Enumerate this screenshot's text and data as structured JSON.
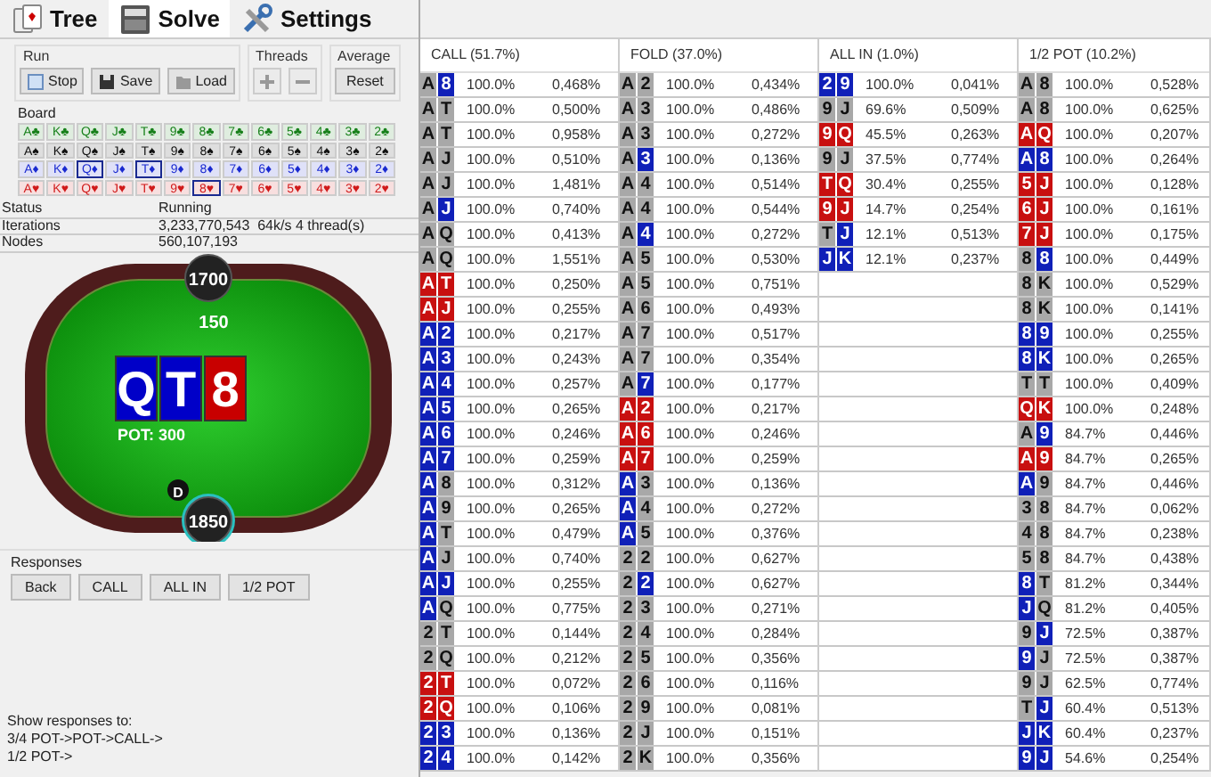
{
  "tabs": [
    {
      "label": "Tree",
      "kind": "tree",
      "selected": false
    },
    {
      "label": "Solve",
      "kind": "solve",
      "selected": true
    },
    {
      "label": "Settings",
      "kind": "settings",
      "selected": false
    }
  ],
  "run": {
    "title": "Run",
    "buttons": [
      {
        "label": "Stop",
        "kind": "stop"
      },
      {
        "label": "Save",
        "kind": "save"
      },
      {
        "label": "Load",
        "kind": "load"
      }
    ]
  },
  "threads": {
    "title": "Threads",
    "buttons": [
      {
        "kind": "plus",
        "disabled": true
      },
      {
        "kind": "minus",
        "disabled": true
      }
    ]
  },
  "average": {
    "title": "Average",
    "button": "Reset"
  },
  "board": {
    "title": "Board",
    "rows": [
      {
        "color": "#17801a",
        "cards": [
          {
            "label": "A♣",
            "selected": false
          },
          {
            "label": "K♣",
            "selected": false
          },
          {
            "label": "Q♣",
            "selected": false
          },
          {
            "label": "J♣",
            "selected": false
          },
          {
            "label": "T♣",
            "selected": false
          },
          {
            "label": "9♣",
            "selected": false
          },
          {
            "label": "8♣",
            "selected": false
          },
          {
            "label": "7♣",
            "selected": false
          },
          {
            "label": "6♣",
            "selected": false
          },
          {
            "label": "5♣",
            "selected": false
          },
          {
            "label": "4♣",
            "selected": false
          },
          {
            "label": "3♣",
            "selected": false
          },
          {
            "label": "2♣",
            "selected": false
          }
        ]
      },
      {
        "color": "#111111",
        "cards": [
          {
            "label": "A♠",
            "selected": false
          },
          {
            "label": "K♠",
            "selected": false
          },
          {
            "label": "Q♠",
            "selected": false
          },
          {
            "label": "J♠",
            "selected": false
          },
          {
            "label": "T♠",
            "selected": false
          },
          {
            "label": "9♠",
            "selected": false
          },
          {
            "label": "8♠",
            "selected": false
          },
          {
            "label": "7♠",
            "selected": false
          },
          {
            "label": "6♠",
            "selected": false
          },
          {
            "label": "5♠",
            "selected": false
          },
          {
            "label": "4♠",
            "selected": false
          },
          {
            "label": "3♠",
            "selected": false
          },
          {
            "label": "2♠",
            "selected": false
          }
        ]
      },
      {
        "color": "#1a2ad0",
        "cards": [
          {
            "label": "A♦",
            "selected": false
          },
          {
            "label": "K♦",
            "selected": false
          },
          {
            "label": "Q♦",
            "selected": true
          },
          {
            "label": "J♦",
            "selected": false
          },
          {
            "label": "T♦",
            "selected": true
          },
          {
            "label": "9♦",
            "selected": false
          },
          {
            "label": "8♦",
            "selected": false
          },
          {
            "label": "7♦",
            "selected": false
          },
          {
            "label": "6♦",
            "selected": false
          },
          {
            "label": "5♦",
            "selected": false
          },
          {
            "label": "4♦",
            "selected": false
          },
          {
            "label": "3♦",
            "selected": false
          },
          {
            "label": "2♦",
            "selected": false
          }
        ]
      },
      {
        "color": "#d01a1a",
        "cards": [
          {
            "label": "A♥",
            "selected": false
          },
          {
            "label": "K♥",
            "selected": false
          },
          {
            "label": "Q♥",
            "selected": false
          },
          {
            "label": "J♥",
            "selected": false
          },
          {
            "label": "T♥",
            "selected": false
          },
          {
            "label": "9♥",
            "selected": false
          },
          {
            "label": "8♥",
            "selected": true
          },
          {
            "label": "7♥",
            "selected": false
          },
          {
            "label": "6♥",
            "selected": false
          },
          {
            "label": "5♥",
            "selected": false
          },
          {
            "label": "4♥",
            "selected": false
          },
          {
            "label": "3♥",
            "selected": false
          },
          {
            "label": "2♥",
            "selected": false
          }
        ]
      }
    ]
  },
  "status": [
    {
      "label": "Status",
      "value": "Running"
    },
    {
      "label": "Iterations",
      "value": "3,233,770,543  64k/s 4 thread(s)"
    },
    {
      "label": "Nodes",
      "value": "560,107,193"
    }
  ],
  "table": {
    "top_stack": "1700",
    "bet": "150",
    "board": [
      {
        "rank": "Q",
        "color": "#0000c8"
      },
      {
        "rank": "T",
        "color": "#0000c8"
      },
      {
        "rank": "8",
        "color": "#c80000"
      }
    ],
    "pot": "POT: 300",
    "dealer": "D",
    "bottom_stack": "1850"
  },
  "responses": {
    "title": "Responses",
    "buttons": [
      "Back",
      "CALL",
      "ALL IN",
      "1/2 POT"
    ]
  },
  "show_responses": [
    "Show responses to:",
    "3/4 POT->POT->CALL->",
    "1/2 POT->"
  ],
  "strategy": [
    {
      "header": "CALL (51.7%)",
      "rows": [
        {
          "hand": [
            {
              "rank": "A",
              "color": "#a8a8a8"
            },
            {
              "rank": "8",
              "color": "#1020b8"
            }
          ],
          "frequency": "100.0%",
          "weight": "0,468%"
        },
        {
          "hand": [
            {
              "rank": "A",
              "color": "#a8a8a8"
            },
            {
              "rank": "T",
              "color": "#a8a8a8"
            }
          ],
          "frequency": "100.0%",
          "weight": "0,500%"
        },
        {
          "hand": [
            {
              "rank": "A",
              "color": "#a8a8a8"
            },
            {
              "rank": "T",
              "color": "#a8a8a8"
            }
          ],
          "frequency": "100.0%",
          "weight": "0,958%"
        },
        {
          "hand": [
            {
              "rank": "A",
              "color": "#a8a8a8"
            },
            {
              "rank": "J",
              "color": "#a8a8a8"
            }
          ],
          "frequency": "100.0%",
          "weight": "0,510%"
        },
        {
          "hand": [
            {
              "rank": "A",
              "color": "#a8a8a8"
            },
            {
              "rank": "J",
              "color": "#a8a8a8"
            }
          ],
          "frequency": "100.0%",
          "weight": "1,481%"
        },
        {
          "hand": [
            {
              "rank": "A",
              "color": "#a8a8a8"
            },
            {
              "rank": "J",
              "color": "#1020b8"
            }
          ],
          "frequency": "100.0%",
          "weight": "0,740%"
        },
        {
          "hand": [
            {
              "rank": "A",
              "color": "#a8a8a8"
            },
            {
              "rank": "Q",
              "color": "#a8a8a8"
            }
          ],
          "frequency": "100.0%",
          "weight": "0,413%"
        },
        {
          "hand": [
            {
              "rank": "A",
              "color": "#a8a8a8"
            },
            {
              "rank": "Q",
              "color": "#a8a8a8"
            }
          ],
          "frequency": "100.0%",
          "weight": "1,551%"
        },
        {
          "hand": [
            {
              "rank": "A",
              "color": "#c81010"
            },
            {
              "rank": "T",
              "color": "#c81010"
            }
          ],
          "frequency": "100.0%",
          "weight": "0,250%"
        },
        {
          "hand": [
            {
              "rank": "A",
              "color": "#c81010"
            },
            {
              "rank": "J",
              "color": "#c81010"
            }
          ],
          "frequency": "100.0%",
          "weight": "0,255%"
        },
        {
          "hand": [
            {
              "rank": "A",
              "color": "#1020b8"
            },
            {
              "rank": "2",
              "color": "#1020b8"
            }
          ],
          "frequency": "100.0%",
          "weight": "0,217%"
        },
        {
          "hand": [
            {
              "rank": "A",
              "color": "#1020b8"
            },
            {
              "rank": "3",
              "color": "#1020b8"
            }
          ],
          "frequency": "100.0%",
          "weight": "0,243%"
        },
        {
          "hand": [
            {
              "rank": "A",
              "color": "#1020b8"
            },
            {
              "rank": "4",
              "color": "#1020b8"
            }
          ],
          "frequency": "100.0%",
          "weight": "0,257%"
        },
        {
          "hand": [
            {
              "rank": "A",
              "color": "#1020b8"
            },
            {
              "rank": "5",
              "color": "#1020b8"
            }
          ],
          "frequency": "100.0%",
          "weight": "0,265%"
        },
        {
          "hand": [
            {
              "rank": "A",
              "color": "#1020b8"
            },
            {
              "rank": "6",
              "color": "#1020b8"
            }
          ],
          "frequency": "100.0%",
          "weight": "0,246%"
        },
        {
          "hand": [
            {
              "rank": "A",
              "color": "#1020b8"
            },
            {
              "rank": "7",
              "color": "#1020b8"
            }
          ],
          "frequency": "100.0%",
          "weight": "0,259%"
        },
        {
          "hand": [
            {
              "rank": "A",
              "color": "#1020b8"
            },
            {
              "rank": "8",
              "color": "#a8a8a8"
            }
          ],
          "frequency": "100.0%",
          "weight": "0,312%"
        },
        {
          "hand": [
            {
              "rank": "A",
              "color": "#1020b8"
            },
            {
              "rank": "9",
              "color": "#a8a8a8"
            }
          ],
          "frequency": "100.0%",
          "weight": "0,265%"
        },
        {
          "hand": [
            {
              "rank": "A",
              "color": "#1020b8"
            },
            {
              "rank": "T",
              "color": "#a8a8a8"
            }
          ],
          "frequency": "100.0%",
          "weight": "0,479%"
        },
        {
          "hand": [
            {
              "rank": "A",
              "color": "#1020b8"
            },
            {
              "rank": "J",
              "color": "#a8a8a8"
            }
          ],
          "frequency": "100.0%",
          "weight": "0,740%"
        },
        {
          "hand": [
            {
              "rank": "A",
              "color": "#1020b8"
            },
            {
              "rank": "J",
              "color": "#1020b8"
            }
          ],
          "frequency": "100.0%",
          "weight": "0,255%"
        },
        {
          "hand": [
            {
              "rank": "A",
              "color": "#1020b8"
            },
            {
              "rank": "Q",
              "color": "#a8a8a8"
            }
          ],
          "frequency": "100.0%",
          "weight": "0,775%"
        },
        {
          "hand": [
            {
              "rank": "2",
              "color": "#a8a8a8"
            },
            {
              "rank": "T",
              "color": "#a8a8a8"
            }
          ],
          "frequency": "100.0%",
          "weight": "0,144%"
        },
        {
          "hand": [
            {
              "rank": "2",
              "color": "#a8a8a8"
            },
            {
              "rank": "Q",
              "color": "#a8a8a8"
            }
          ],
          "frequency": "100.0%",
          "weight": "0,212%"
        },
        {
          "hand": [
            {
              "rank": "2",
              "color": "#c81010"
            },
            {
              "rank": "T",
              "color": "#c81010"
            }
          ],
          "frequency": "100.0%",
          "weight": "0,072%"
        },
        {
          "hand": [
            {
              "rank": "2",
              "color": "#c81010"
            },
            {
              "rank": "Q",
              "color": "#c81010"
            }
          ],
          "frequency": "100.0%",
          "weight": "0,106%"
        },
        {
          "hand": [
            {
              "rank": "2",
              "color": "#1020b8"
            },
            {
              "rank": "3",
              "color": "#1020b8"
            }
          ],
          "frequency": "100.0%",
          "weight": "0,136%"
        },
        {
          "hand": [
            {
              "rank": "2",
              "color": "#1020b8"
            },
            {
              "rank": "4",
              "color": "#1020b8"
            }
          ],
          "frequency": "100.0%",
          "weight": "0,142%"
        }
      ]
    },
    {
      "header": "FOLD (37.0%)",
      "rows": [
        {
          "hand": [
            {
              "rank": "A",
              "color": "#a8a8a8"
            },
            {
              "rank": "2",
              "color": "#a8a8a8"
            }
          ],
          "frequency": "100.0%",
          "weight": "0,434%"
        },
        {
          "hand": [
            {
              "rank": "A",
              "color": "#a8a8a8"
            },
            {
              "rank": "3",
              "color": "#a8a8a8"
            }
          ],
          "frequency": "100.0%",
          "weight": "0,486%"
        },
        {
          "hand": [
            {
              "rank": "A",
              "color": "#a8a8a8"
            },
            {
              "rank": "3",
              "color": "#a8a8a8"
            }
          ],
          "frequency": "100.0%",
          "weight": "0,272%"
        },
        {
          "hand": [
            {
              "rank": "A",
              "color": "#a8a8a8"
            },
            {
              "rank": "3",
              "color": "#1020b8"
            }
          ],
          "frequency": "100.0%",
          "weight": "0,136%"
        },
        {
          "hand": [
            {
              "rank": "A",
              "color": "#a8a8a8"
            },
            {
              "rank": "4",
              "color": "#a8a8a8"
            }
          ],
          "frequency": "100.0%",
          "weight": "0,514%"
        },
        {
          "hand": [
            {
              "rank": "A",
              "color": "#a8a8a8"
            },
            {
              "rank": "4",
              "color": "#a8a8a8"
            }
          ],
          "frequency": "100.0%",
          "weight": "0,544%"
        },
        {
          "hand": [
            {
              "rank": "A",
              "color": "#a8a8a8"
            },
            {
              "rank": "4",
              "color": "#1020b8"
            }
          ],
          "frequency": "100.0%",
          "weight": "0,272%"
        },
        {
          "hand": [
            {
              "rank": "A",
              "color": "#a8a8a8"
            },
            {
              "rank": "5",
              "color": "#a8a8a8"
            }
          ],
          "frequency": "100.0%",
          "weight": "0,530%"
        },
        {
          "hand": [
            {
              "rank": "A",
              "color": "#a8a8a8"
            },
            {
              "rank": "5",
              "color": "#a8a8a8"
            }
          ],
          "frequency": "100.0%",
          "weight": "0,751%"
        },
        {
          "hand": [
            {
              "rank": "A",
              "color": "#a8a8a8"
            },
            {
              "rank": "6",
              "color": "#a8a8a8"
            }
          ],
          "frequency": "100.0%",
          "weight": "0,493%"
        },
        {
          "hand": [
            {
              "rank": "A",
              "color": "#a8a8a8"
            },
            {
              "rank": "7",
              "color": "#a8a8a8"
            }
          ],
          "frequency": "100.0%",
          "weight": "0,517%"
        },
        {
          "hand": [
            {
              "rank": "A",
              "color": "#a8a8a8"
            },
            {
              "rank": "7",
              "color": "#a8a8a8"
            }
          ],
          "frequency": "100.0%",
          "weight": "0,354%"
        },
        {
          "hand": [
            {
              "rank": "A",
              "color": "#a8a8a8"
            },
            {
              "rank": "7",
              "color": "#1020b8"
            }
          ],
          "frequency": "100.0%",
          "weight": "0,177%"
        },
        {
          "hand": [
            {
              "rank": "A",
              "color": "#c81010"
            },
            {
              "rank": "2",
              "color": "#c81010"
            }
          ],
          "frequency": "100.0%",
          "weight": "0,217%"
        },
        {
          "hand": [
            {
              "rank": "A",
              "color": "#c81010"
            },
            {
              "rank": "6",
              "color": "#c81010"
            }
          ],
          "frequency": "100.0%",
          "weight": "0,246%"
        },
        {
          "hand": [
            {
              "rank": "A",
              "color": "#c81010"
            },
            {
              "rank": "7",
              "color": "#c81010"
            }
          ],
          "frequency": "100.0%",
          "weight": "0,259%"
        },
        {
          "hand": [
            {
              "rank": "A",
              "color": "#1020b8"
            },
            {
              "rank": "3",
              "color": "#a8a8a8"
            }
          ],
          "frequency": "100.0%",
          "weight": "0,136%"
        },
        {
          "hand": [
            {
              "rank": "A",
              "color": "#1020b8"
            },
            {
              "rank": "4",
              "color": "#a8a8a8"
            }
          ],
          "frequency": "100.0%",
          "weight": "0,272%"
        },
        {
          "hand": [
            {
              "rank": "A",
              "color": "#1020b8"
            },
            {
              "rank": "5",
              "color": "#a8a8a8"
            }
          ],
          "frequency": "100.0%",
          "weight": "0,376%"
        },
        {
          "hand": [
            {
              "rank": "2",
              "color": "#a8a8a8"
            },
            {
              "rank": "2",
              "color": "#a8a8a8"
            }
          ],
          "frequency": "100.0%",
          "weight": "0,627%"
        },
        {
          "hand": [
            {
              "rank": "2",
              "color": "#a8a8a8"
            },
            {
              "rank": "2",
              "color": "#1020b8"
            }
          ],
          "frequency": "100.0%",
          "weight": "0,627%"
        },
        {
          "hand": [
            {
              "rank": "2",
              "color": "#a8a8a8"
            },
            {
              "rank": "3",
              "color": "#a8a8a8"
            }
          ],
          "frequency": "100.0%",
          "weight": "0,271%"
        },
        {
          "hand": [
            {
              "rank": "2",
              "color": "#a8a8a8"
            },
            {
              "rank": "4",
              "color": "#a8a8a8"
            }
          ],
          "frequency": "100.0%",
          "weight": "0,284%"
        },
        {
          "hand": [
            {
              "rank": "2",
              "color": "#a8a8a8"
            },
            {
              "rank": "5",
              "color": "#a8a8a8"
            }
          ],
          "frequency": "100.0%",
          "weight": "0,356%"
        },
        {
          "hand": [
            {
              "rank": "2",
              "color": "#a8a8a8"
            },
            {
              "rank": "6",
              "color": "#a8a8a8"
            }
          ],
          "frequency": "100.0%",
          "weight": "0,116%"
        },
        {
          "hand": [
            {
              "rank": "2",
              "color": "#a8a8a8"
            },
            {
              "rank": "9",
              "color": "#a8a8a8"
            }
          ],
          "frequency": "100.0%",
          "weight": "0,081%"
        },
        {
          "hand": [
            {
              "rank": "2",
              "color": "#a8a8a8"
            },
            {
              "rank": "J",
              "color": "#a8a8a8"
            }
          ],
          "frequency": "100.0%",
          "weight": "0,151%"
        },
        {
          "hand": [
            {
              "rank": "2",
              "color": "#a8a8a8"
            },
            {
              "rank": "K",
              "color": "#a8a8a8"
            }
          ],
          "frequency": "100.0%",
          "weight": "0,356%"
        }
      ]
    },
    {
      "header": "ALL IN (1.0%)",
      "rows": [
        {
          "hand": [
            {
              "rank": "2",
              "color": "#1020b8"
            },
            {
              "rank": "9",
              "color": "#1020b8"
            }
          ],
          "frequency": "100.0%",
          "weight": "0,041%"
        },
        {
          "hand": [
            {
              "rank": "9",
              "color": "#a8a8a8"
            },
            {
              "rank": "J",
              "color": "#a8a8a8"
            }
          ],
          "frequency": "69.6%",
          "weight": "0,509%"
        },
        {
          "hand": [
            {
              "rank": "9",
              "color": "#c81010"
            },
            {
              "rank": "Q",
              "color": "#c81010"
            }
          ],
          "frequency": "45.5%",
          "weight": "0,263%"
        },
        {
          "hand": [
            {
              "rank": "9",
              "color": "#a8a8a8"
            },
            {
              "rank": "J",
              "color": "#a8a8a8"
            }
          ],
          "frequency": "37.5%",
          "weight": "0,774%"
        },
        {
          "hand": [
            {
              "rank": "T",
              "color": "#c81010"
            },
            {
              "rank": "Q",
              "color": "#c81010"
            }
          ],
          "frequency": "30.4%",
          "weight": "0,255%"
        },
        {
          "hand": [
            {
              "rank": "9",
              "color": "#c81010"
            },
            {
              "rank": "J",
              "color": "#c81010"
            }
          ],
          "frequency": "14.7%",
          "weight": "0,254%"
        },
        {
          "hand": [
            {
              "rank": "T",
              "color": "#a8a8a8"
            },
            {
              "rank": "J",
              "color": "#1020b8"
            }
          ],
          "frequency": "12.1%",
          "weight": "0,513%"
        },
        {
          "hand": [
            {
              "rank": "J",
              "color": "#1020b8"
            },
            {
              "rank": "K",
              "color": "#1020b8"
            }
          ],
          "frequency": "12.1%",
          "weight": "0,237%"
        }
      ]
    },
    {
      "header": "1/2 POT (10.2%)",
      "rows": [
        {
          "hand": [
            {
              "rank": "A",
              "color": "#a8a8a8"
            },
            {
              "rank": "8",
              "color": "#a8a8a8"
            }
          ],
          "frequency": "100.0%",
          "weight": "0,528%"
        },
        {
          "hand": [
            {
              "rank": "A",
              "color": "#a8a8a8"
            },
            {
              "rank": "8",
              "color": "#a8a8a8"
            }
          ],
          "frequency": "100.0%",
          "weight": "0,625%"
        },
        {
          "hand": [
            {
              "rank": "A",
              "color": "#c81010"
            },
            {
              "rank": "Q",
              "color": "#c81010"
            }
          ],
          "frequency": "100.0%",
          "weight": "0,207%"
        },
        {
          "hand": [
            {
              "rank": "A",
              "color": "#1020b8"
            },
            {
              "rank": "8",
              "color": "#1020b8"
            }
          ],
          "frequency": "100.0%",
          "weight": "0,264%"
        },
        {
          "hand": [
            {
              "rank": "5",
              "color": "#c81010"
            },
            {
              "rank": "J",
              "color": "#c81010"
            }
          ],
          "frequency": "100.0%",
          "weight": "0,128%"
        },
        {
          "hand": [
            {
              "rank": "6",
              "color": "#c81010"
            },
            {
              "rank": "J",
              "color": "#c81010"
            }
          ],
          "frequency": "100.0%",
          "weight": "0,161%"
        },
        {
          "hand": [
            {
              "rank": "7",
              "color": "#c81010"
            },
            {
              "rank": "J",
              "color": "#c81010"
            }
          ],
          "frequency": "100.0%",
          "weight": "0,175%"
        },
        {
          "hand": [
            {
              "rank": "8",
              "color": "#a8a8a8"
            },
            {
              "rank": "8",
              "color": "#1020b8"
            }
          ],
          "frequency": "100.0%",
          "weight": "0,449%"
        },
        {
          "hand": [
            {
              "rank": "8",
              "color": "#a8a8a8"
            },
            {
              "rank": "K",
              "color": "#a8a8a8"
            }
          ],
          "frequency": "100.0%",
          "weight": "0,529%"
        },
        {
          "hand": [
            {
              "rank": "8",
              "color": "#a8a8a8"
            },
            {
              "rank": "K",
              "color": "#a8a8a8"
            }
          ],
          "frequency": "100.0%",
          "weight": "0,141%"
        },
        {
          "hand": [
            {
              "rank": "8",
              "color": "#1020b8"
            },
            {
              "rank": "9",
              "color": "#1020b8"
            }
          ],
          "frequency": "100.0%",
          "weight": "0,255%"
        },
        {
          "hand": [
            {
              "rank": "8",
              "color": "#1020b8"
            },
            {
              "rank": "K",
              "color": "#1020b8"
            }
          ],
          "frequency": "100.0%",
          "weight": "0,265%"
        },
        {
          "hand": [
            {
              "rank": "T",
              "color": "#a8a8a8"
            },
            {
              "rank": "T",
              "color": "#a8a8a8"
            }
          ],
          "frequency": "100.0%",
          "weight": "0,409%"
        },
        {
          "hand": [
            {
              "rank": "Q",
              "color": "#c81010"
            },
            {
              "rank": "K",
              "color": "#c81010"
            }
          ],
          "frequency": "100.0%",
          "weight": "0,248%"
        },
        {
          "hand": [
            {
              "rank": "A",
              "color": "#a8a8a8"
            },
            {
              "rank": "9",
              "color": "#1020b8"
            }
          ],
          "frequency": "84.7%",
          "weight": "0,446%"
        },
        {
          "hand": [
            {
              "rank": "A",
              "color": "#c81010"
            },
            {
              "rank": "9",
              "color": "#c81010"
            }
          ],
          "frequency": "84.7%",
          "weight": "0,265%"
        },
        {
          "hand": [
            {
              "rank": "A",
              "color": "#1020b8"
            },
            {
              "rank": "9",
              "color": "#a8a8a8"
            }
          ],
          "frequency": "84.7%",
          "weight": "0,446%"
        },
        {
          "hand": [
            {
              "rank": "3",
              "color": "#a8a8a8"
            },
            {
              "rank": "8",
              "color": "#a8a8a8"
            }
          ],
          "frequency": "84.7%",
          "weight": "0,062%"
        },
        {
          "hand": [
            {
              "rank": "4",
              "color": "#a8a8a8"
            },
            {
              "rank": "8",
              "color": "#a8a8a8"
            }
          ],
          "frequency": "84.7%",
          "weight": "0,238%"
        },
        {
          "hand": [
            {
              "rank": "5",
              "color": "#a8a8a8"
            },
            {
              "rank": "8",
              "color": "#a8a8a8"
            }
          ],
          "frequency": "84.7%",
          "weight": "0,438%"
        },
        {
          "hand": [
            {
              "rank": "8",
              "color": "#1020b8"
            },
            {
              "rank": "T",
              "color": "#a8a8a8"
            }
          ],
          "frequency": "81.2%",
          "weight": "0,344%"
        },
        {
          "hand": [
            {
              "rank": "J",
              "color": "#1020b8"
            },
            {
              "rank": "Q",
              "color": "#a8a8a8"
            }
          ],
          "frequency": "81.2%",
          "weight": "0,405%"
        },
        {
          "hand": [
            {
              "rank": "9",
              "color": "#a8a8a8"
            },
            {
              "rank": "J",
              "color": "#1020b8"
            }
          ],
          "frequency": "72.5%",
          "weight": "0,387%"
        },
        {
          "hand": [
            {
              "rank": "9",
              "color": "#1020b8"
            },
            {
              "rank": "J",
              "color": "#a8a8a8"
            }
          ],
          "frequency": "72.5%",
          "weight": "0,387%"
        },
        {
          "hand": [
            {
              "rank": "9",
              "color": "#a8a8a8"
            },
            {
              "rank": "J",
              "color": "#a8a8a8"
            }
          ],
          "frequency": "62.5%",
          "weight": "0,774%"
        },
        {
          "hand": [
            {
              "rank": "T",
              "color": "#a8a8a8"
            },
            {
              "rank": "J",
              "color": "#1020b8"
            }
          ],
          "frequency": "60.4%",
          "weight": "0,513%"
        },
        {
          "hand": [
            {
              "rank": "J",
              "color": "#1020b8"
            },
            {
              "rank": "K",
              "color": "#1020b8"
            }
          ],
          "frequency": "60.4%",
          "weight": "0,237%"
        },
        {
          "hand": [
            {
              "rank": "9",
              "color": "#1020b8"
            },
            {
              "rank": "J",
              "color": "#1020b8"
            }
          ],
          "frequency": "54.6%",
          "weight": "0,254%"
        }
      ]
    }
  ]
}
